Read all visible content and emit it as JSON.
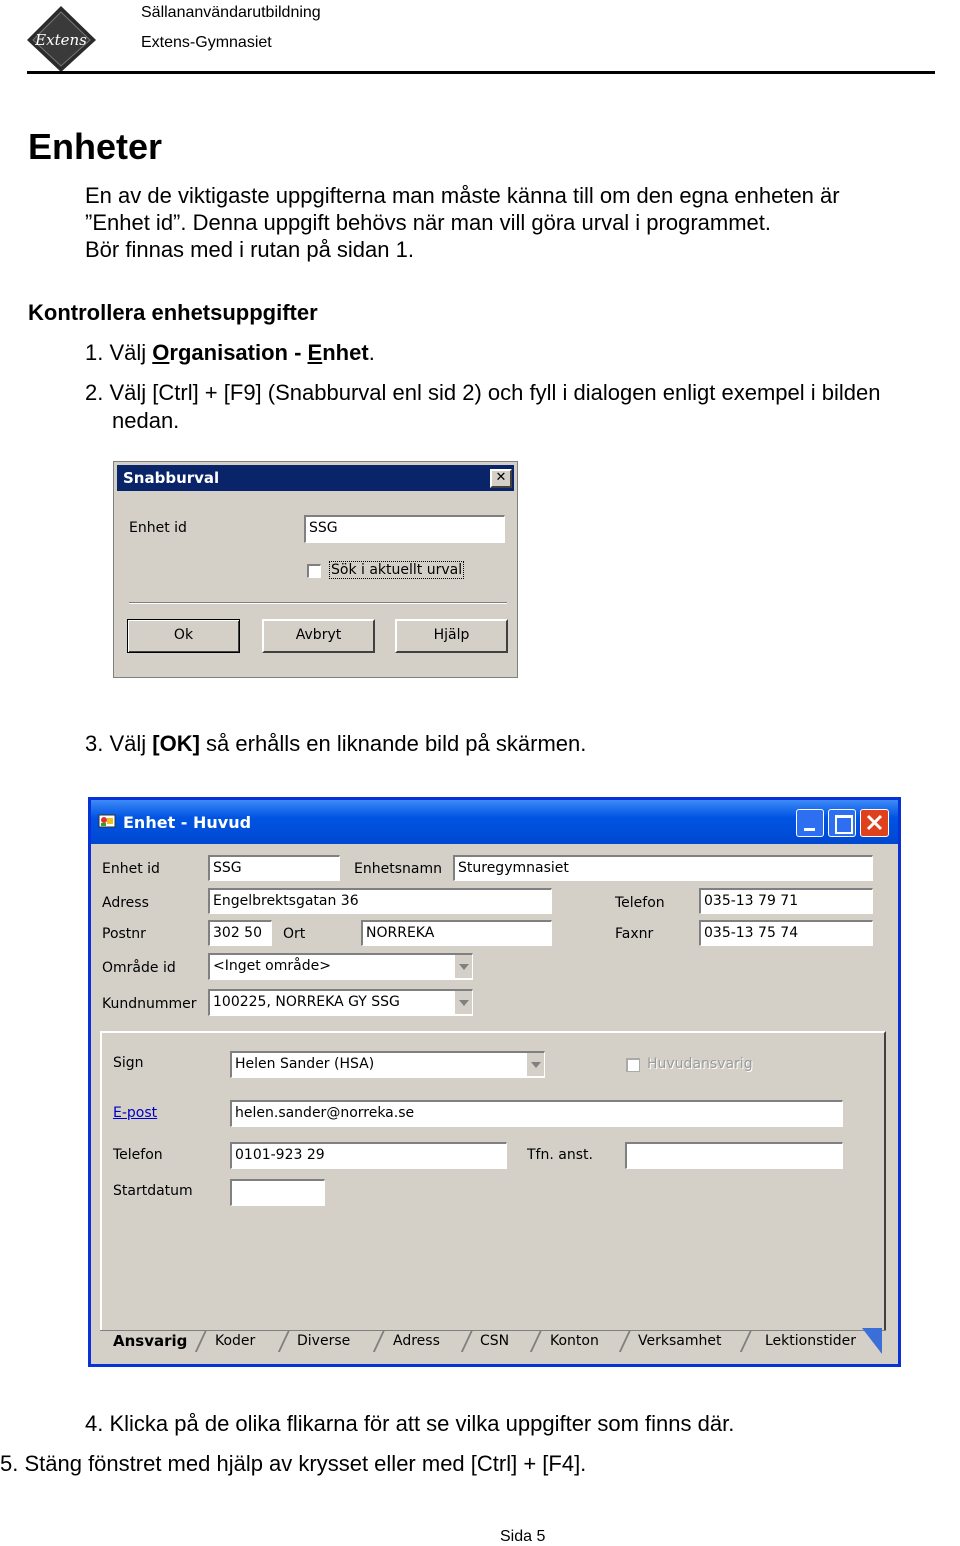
{
  "header": {
    "line1": "Sällananvändarutbildning",
    "line2": "Extens-Gymnasiet",
    "logo_text": "Extens"
  },
  "title": "Enheter",
  "intro": [
    "En av de viktigaste uppgifterna man måste känna till om den egna enheten är",
    "”Enhet id”. Denna uppgift behövs när man vill göra urval i programmet.",
    "Bör finnas med i rutan på sidan 1."
  ],
  "subheading": "Kontrollera enhetsuppgifter",
  "step1": {
    "num": "1.",
    "pre": "Välj ",
    "menu1_first": "O",
    "menu1_rest": "rganisation",
    "sep": " - ",
    "menu2_first": "E",
    "menu2_rest": "nhet",
    "post": "."
  },
  "step2": {
    "line1": "2. Välj [Ctrl] + [F9]  (Snabburval enl sid 2) och fyll i dialogen enligt exempel i bilden",
    "line2": "nedan."
  },
  "dialog1": {
    "title": "Snabburval",
    "enhet_label": "Enhet id",
    "enhet_value": "SSG",
    "checkbox_label": "Sök i aktuellt urval",
    "ok": "Ok",
    "cancel": "Avbryt",
    "help": "Hjälp",
    "close": "✕"
  },
  "step3": {
    "pre": "3. Välj ",
    "bold": "[OK]",
    "post": " så erhålls en liknande bild på skärmen."
  },
  "dialog2": {
    "title": "Enhet - Huvud",
    "labels": {
      "enhet_id": "Enhet id",
      "enhetsnamn": "Enhetsnamn",
      "adress": "Adress",
      "telefon": "Telefon",
      "postnr": "Postnr",
      "ort": "Ort",
      "faxnr": "Faxnr",
      "omrade": "Område id",
      "kundnummer": "Kundnummer",
      "sign": "Sign",
      "huvudansvarig": "Huvudansvarig",
      "epost": "E-post",
      "telefon2": "Telefon",
      "tfn_anst": "Tfn. anst.",
      "startdatum": "Startdatum"
    },
    "values": {
      "enhet_id": "SSG",
      "enhetsnamn": "Sturegymnasiet",
      "adress": "Engelbrektsgatan 36",
      "telefon": "035-13 79 71",
      "postnr": "302 50",
      "ort": "NORREKA",
      "faxnr": "035-13 75 74",
      "omrade": "<Inget område>",
      "kundnummer": "100225, NORREKA GY SSG",
      "sign": "Helen Sander (HSA)",
      "epost": "helen.sander@norreka.se",
      "telefon2": "0101-923 29",
      "tfn_anst": "",
      "startdatum": ""
    },
    "tabs": [
      "Ansvarig",
      "Koder",
      "Diverse",
      "Adress",
      "CSN",
      "Konton",
      "Verksamhet",
      "Lektionstider"
    ],
    "active_tab": "Ansvarig"
  },
  "step4": "4. Klicka på de olika flikarna för att se vilka uppgifter som finns där.",
  "step5": "5. Stäng fönstret med hjälp av krysset eller med [Ctrl] + [F4].",
  "footer": "Sida 5",
  "colors": {
    "titlebar_blue": "#0a246a",
    "xp_blue": "#0054e3",
    "xp_close": "#e0411d",
    "face": "#d4d0c8"
  }
}
